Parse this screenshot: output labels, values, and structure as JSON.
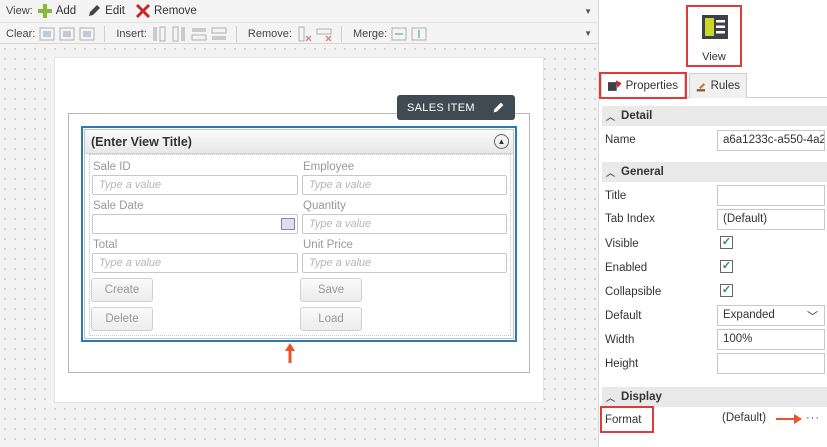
{
  "toolbar": {
    "row1": {
      "label": "View:",
      "add_label": "Add",
      "edit_label": "Edit",
      "remove_label": "Remove"
    },
    "row2": {
      "clear_label": "Clear:",
      "insert_label": "Insert:",
      "remove_label": "Remove:",
      "merge_label": "Merge:"
    }
  },
  "canvas": {
    "badge_label": "SALES ITEM",
    "view_title": "(Enter View Title)",
    "fields": [
      {
        "label": "Sale ID",
        "placeholder": "Type a value"
      },
      {
        "label": "Employee",
        "placeholder": "Type a value"
      },
      {
        "label": "Sale Date",
        "placeholder": ""
      },
      {
        "label": "Quantity",
        "placeholder": "Type a value"
      },
      {
        "label": "Total",
        "placeholder": "Type a value"
      },
      {
        "label": "Unit Price",
        "placeholder": "Type a value"
      }
    ],
    "buttons": {
      "create": "Create",
      "save": "Save",
      "delete": "Delete",
      "load": "Load"
    }
  },
  "right_panel": {
    "view_tile_label": "View",
    "tabs": {
      "properties": "Properties",
      "rules": "Rules"
    },
    "sections": {
      "detail": "Detail",
      "general": "General",
      "display": "Display"
    },
    "properties": {
      "name_label": "Name",
      "name_value": "a6a1233c-a550-4a2",
      "title_label": "Title",
      "title_value": "",
      "tab_index_label": "Tab Index",
      "tab_index_value": "(Default)",
      "visible_label": "Visible",
      "enabled_label": "Enabled",
      "collapsible_label": "Collapsible",
      "default_label": "Default",
      "default_value": "Expanded",
      "width_label": "Width",
      "width_value": "100%",
      "height_label": "Height",
      "height_value": "",
      "format_label": "Format",
      "format_value": "(Default)",
      "format_ellipsis": "···"
    }
  },
  "colors": {
    "highlight": "#e03a3a",
    "selection_border": "#2a7ab8",
    "check_green": "#1f9a3b",
    "badge_bg": "#3f4a52"
  }
}
